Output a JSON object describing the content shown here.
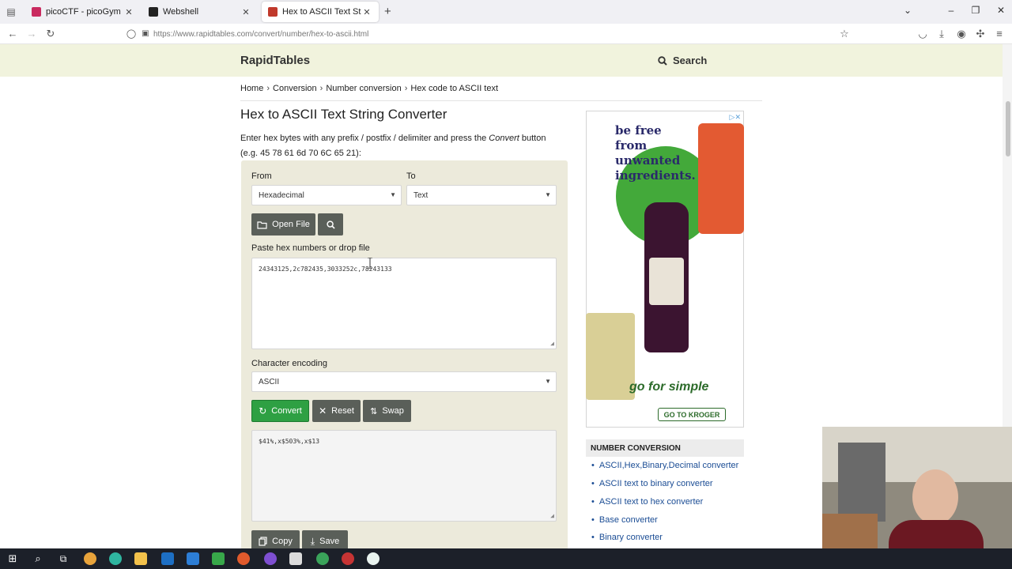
{
  "browser": {
    "tabs": [
      {
        "title": "picoCTF - picoGym Challenges",
        "favicon_color": "#c92a5f"
      },
      {
        "title": "Webshell",
        "favicon_color": "#222222"
      },
      {
        "title": "Hex to ASCII Text String Conve",
        "favicon_color": "#c0392b"
      }
    ],
    "url": "https://www.rapidtables.com/convert/number/hex-to-ascii.html"
  },
  "site": {
    "logo": "RapidTables",
    "search_label": "Search",
    "breadcrumb": [
      "Home",
      "Conversion",
      "Number conversion",
      "Hex code to ASCII text"
    ],
    "title": "Hex to ASCII Text String Converter",
    "intro_before": "Enter hex bytes with any prefix / postfix / delimiter and press the ",
    "intro_em": "Convert",
    "intro_after": " button",
    "intro_example": "(e.g. 45 78 61 6d 70 6C 65 21):"
  },
  "converter": {
    "from_label": "From",
    "from_value": "Hexadecimal",
    "to_label": "To",
    "to_value": "Text",
    "open_file_label": "Open File",
    "paste_label": "Paste hex numbers or drop file",
    "input_value": "24343125,2c782435,3033252c,78243133",
    "encoding_label": "Character encoding",
    "encoding_value": "ASCII",
    "convert_label": "Convert",
    "reset_label": "Reset",
    "swap_label": "Swap",
    "output_value": "$41%,x$503%,x$13",
    "copy_label": "Copy",
    "save_label": "Save"
  },
  "ad": {
    "headline": "be free from unwanted ingredients.",
    "tagline": "go for simple",
    "cta": "GO TO KROGER"
  },
  "sidebar": {
    "heading": "NUMBER CONVERSION",
    "links": [
      "ASCII,Hex,Binary,Decimal converter",
      "ASCII text to binary converter",
      "ASCII text to hex converter",
      "Base converter",
      "Binary converter"
    ]
  },
  "colors": {
    "header_bg": "#f1f3dd",
    "panel_bg": "#eceadb",
    "convert_green": "#2ea043",
    "button_dark": "#5a5f59",
    "link_blue": "#1a4c94"
  }
}
